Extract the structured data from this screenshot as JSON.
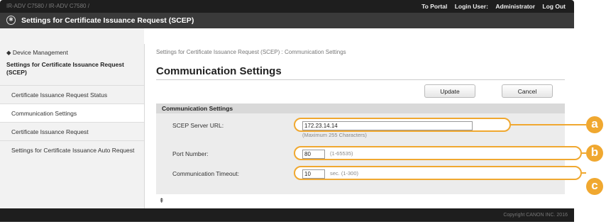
{
  "header": {
    "device_path": "IR-ADV C7580 / IR-ADV C7580 /",
    "links": [
      "To Portal",
      "Login User:",
      "Administrator",
      "Log Out"
    ]
  },
  "titlebar": {
    "title": "Settings for Certificate Issuance Request (SCEP)",
    "icon": "settings-cog-icon"
  },
  "sidebar": {
    "back_link": "◆ Device Management",
    "section_title": "Settings for Certificate Issuance Request (SCEP)",
    "items": [
      {
        "label": "Certificate Issuance Request Status"
      },
      {
        "label": "Communication Settings"
      },
      {
        "label": "Certificate Issuance Request"
      },
      {
        "label": "Settings for Certificate Issuance Auto Request"
      }
    ]
  },
  "main": {
    "breadcrumb": "Settings for Certificate Issuance Request (SCEP) : Communication Settings",
    "title": "Communication Settings",
    "update_label": "Update",
    "cancel_label": "Cancel",
    "section_title": "Communication Settings",
    "fields": {
      "scep_url": {
        "label": "SCEP Server URL:",
        "value": "172.23.14.14",
        "hint": "(Maximum 255 Characters)"
      },
      "port": {
        "label": "Port Number:",
        "value": "80",
        "hint": "(1-65535)"
      },
      "timeout": {
        "label": "Communication Timeout:",
        "value": "10",
        "unit": "sec. (1-300)"
      }
    },
    "page_top_icon": "⇞"
  },
  "callouts": [
    "a",
    "b",
    "c"
  ],
  "footer": {
    "copyright": "Copyright CANON INC. 2016"
  },
  "colors": {
    "accent": "#f0a830",
    "topbar": "#1e1e1e",
    "titlebar": "#3a3a3a"
  }
}
